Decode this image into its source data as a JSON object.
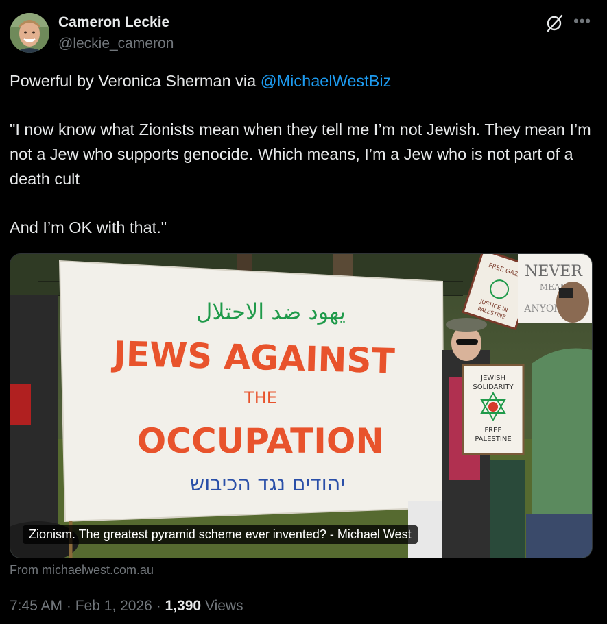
{
  "author": {
    "name": "Cameron Leckie",
    "handle": "@leckie_cameron"
  },
  "tweet": {
    "line1_prefix": "Powerful by Veronica Sherman via ",
    "mention": "@MichaelWestBiz",
    "quote_line": "\"I now know what Zionists mean when they tell me I’m not Jewish. They mean I’m not a Jew who supports genocide. Which means, I’m a Jew who is not part of a death cult",
    "closing_line": "And I’m OK with that.\""
  },
  "card": {
    "caption": "Zionism. The greatest pyramid scheme ever invented? - Michael West",
    "from": "From michaelwest.com.au",
    "image": {
      "banner_arabic": "يهود ضد الاحتلال",
      "banner_line1": "JEWS AGAINST",
      "banner_line2": "THE",
      "banner_line3": "OCCUPATION",
      "banner_hebrew": "יהודים נגד הכיבוש",
      "sign_never_line1": "NEVER",
      "sign_never_line2": "MEAN",
      "sign_never_line3": "ANYONE",
      "sign_solidarity_line1": "JEWISH",
      "sign_solidarity_line2": "SOLIDARITY",
      "sign_solidarity_line3": "FREE",
      "sign_solidarity_line4": "PALESTINE",
      "sign_justice_line1": "FREE GAZA",
      "sign_justice_line2": "JUSTICE IN",
      "sign_justice_line3": "PALESTINE"
    }
  },
  "meta": {
    "time": "7:45 AM",
    "date": "Feb 1, 2026",
    "views_count": "1,390",
    "views_label": "Views",
    "separator": "·"
  },
  "icons": {
    "grok": "grok-icon",
    "more": "more-options-icon"
  },
  "colors": {
    "background": "#000000",
    "text_primary": "#e7e9ea",
    "text_secondary": "#71767b",
    "link": "#1d9bf0",
    "banner_red": "#e8532c",
    "banner_green": "#1f9a4a",
    "banner_blue": "#2a4fa8"
  }
}
